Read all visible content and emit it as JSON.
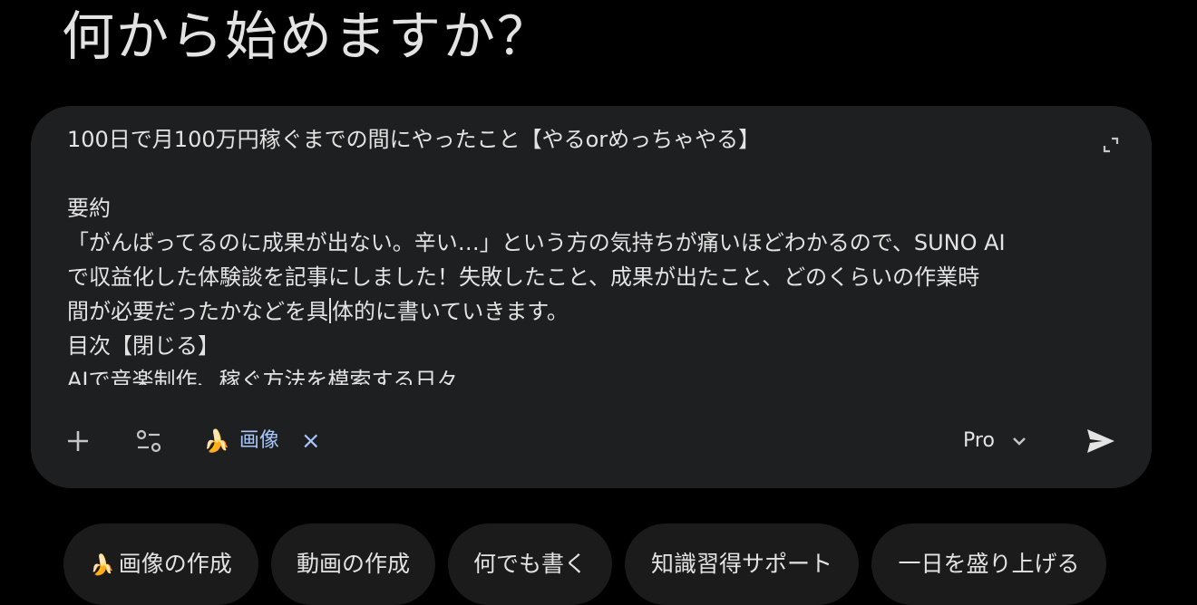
{
  "heading": "何から始めますか？",
  "composer": {
    "lines": [
      "100日で月100万円稼ぐまでの間にやったこと【やるorめっちゃやる】",
      "",
      "要約",
      "「がんばってるのに成果が出ない。辛い…」という方の気持ちが痛いほどわかるので、SUNO AI",
      "で収益化した体験談を記事にしました！失敗したこと、成果が出たこと、どのくらいの作業時",
      "間が必要だったかなどを具",
      "体的に書いていきます。",
      "目次【閉じる】",
      "AIで音楽制作、稼ぐ方法を模索する日々"
    ],
    "expand_icon": "expand-icon"
  },
  "toolbar": {
    "add_icon": "plus-icon",
    "tools_icon": "tools-icon",
    "image_chip": {
      "emoji": "🍌",
      "label": "画像",
      "close": "×"
    },
    "model": {
      "label": "Pro",
      "icon": "chevron-down-icon"
    },
    "send_icon": "send-icon"
  },
  "suggestions": [
    {
      "emoji": "🍌",
      "label": "画像の作成"
    },
    {
      "emoji": "",
      "label": "動画の作成"
    },
    {
      "emoji": "",
      "label": "何でも書く"
    },
    {
      "emoji": "",
      "label": "知識習得サポート"
    },
    {
      "emoji": "",
      "label": "一日を盛り上げる"
    }
  ],
  "colors": {
    "background": "#000000",
    "composer": "#1e1f20",
    "chip_accent": "#a8c7fa",
    "text": "#e3e3e3"
  }
}
